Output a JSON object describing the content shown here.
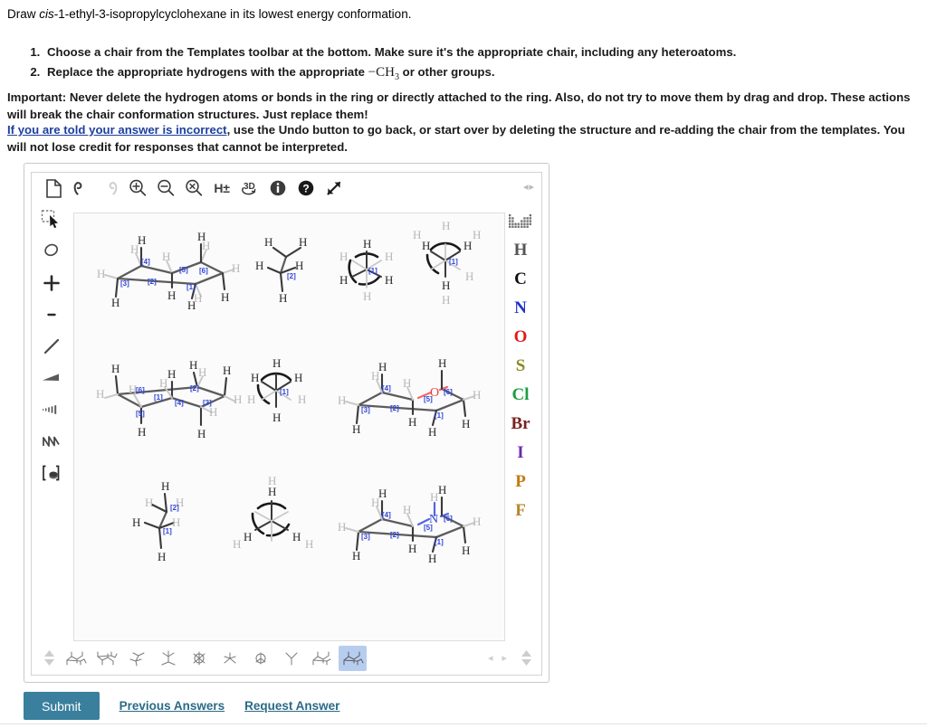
{
  "prompt": {
    "pre": "Draw ",
    "italic": "cis",
    "post": "-1-ethyl-3-isopropylcyclohexane in its lowest energy conformation."
  },
  "steps": [
    "Choose a chair from the Templates toolbar at the bottom. Make sure it's the appropriate chair, including any heteroatoms.",
    "Replace the appropriate hydrogens with the appropriate"
  ],
  "step2_formula": "CH3",
  "step2_tail": "or other groups.",
  "important": "Important: Never delete the hydrogen atoms or bonds in the ring or directly attached to the ring. Also, do not try to move them by drag and drop. These actions will break the chair conformation structures. Just replace them!",
  "note": {
    "link": "If you are told your answer is incorrect",
    "rest": ", use the Undo button to go back, or start over by deleting the structure and re-adding the chair from the templates. You will not lose credit for responses that cannot be interpreted."
  },
  "editor": {
    "toolbar_top": [
      {
        "name": "new-document-icon",
        "label": "New",
        "enabled": true
      },
      {
        "name": "undo-icon",
        "label": "Undo",
        "enabled": true
      },
      {
        "name": "redo-icon",
        "label": "Redo",
        "enabled": false
      },
      {
        "name": "zoom-in-icon",
        "label": "Zoom In",
        "enabled": true
      },
      {
        "name": "zoom-out-icon",
        "label": "Zoom Out",
        "enabled": true
      },
      {
        "name": "zoom-reset-icon",
        "label": "Reset Zoom",
        "enabled": true
      },
      {
        "name": "hydrogen-toggle-icon",
        "label": "H±",
        "enabled": true
      },
      {
        "name": "three-d-icon",
        "label": "3D",
        "enabled": true
      },
      {
        "name": "info-icon",
        "label": "Info",
        "enabled": true
      },
      {
        "name": "help-icon",
        "label": "Help",
        "enabled": true
      },
      {
        "name": "expand-icon",
        "label": "Expand",
        "enabled": true
      }
    ],
    "toolbar_left": [
      {
        "name": "select-tool",
        "label": "Select"
      },
      {
        "name": "eraser-tool",
        "label": "Eraser"
      },
      {
        "name": "increase-charge-tool",
        "label": "+"
      },
      {
        "name": "decrease-charge-tool",
        "label": "-"
      },
      {
        "name": "single-bond-tool",
        "label": "Single bond"
      },
      {
        "name": "wedge-bond-tool",
        "label": "Wedge bond"
      },
      {
        "name": "hash-bond-tool",
        "label": "Hash bond"
      },
      {
        "name": "chain-tool",
        "label": "Chain"
      },
      {
        "name": "bracket-tool",
        "label": "Bracket"
      }
    ],
    "elements": [
      {
        "symbol": "H",
        "color": "#555555"
      },
      {
        "symbol": "C",
        "color": "#101010"
      },
      {
        "symbol": "N",
        "color": "#2233cc"
      },
      {
        "symbol": "O",
        "color": "#e01b1b"
      },
      {
        "symbol": "S",
        "color": "#8a8a21"
      },
      {
        "symbol": "Cl",
        "color": "#1e9e3e"
      },
      {
        "symbol": "Br",
        "color": "#7a2020"
      },
      {
        "symbol": "I",
        "color": "#6a2bb0"
      },
      {
        "symbol": "P",
        "color": "#c27a12"
      },
      {
        "symbol": "F",
        "color": "#b5872a"
      }
    ],
    "periodic_table_icon": "periodic-table-icon",
    "nav_arrows": {
      "left": "◂",
      "right": "▸"
    },
    "canvas_structures": [
      {
        "name": "cyclohexane-chair-a",
        "type": "chair",
        "labels": [
          "[1]",
          "[2]",
          "[3]",
          "[4]",
          "[5]",
          "[6]"
        ],
        "heteroatom": null
      },
      {
        "name": "ethane-sawhorse-a",
        "type": "sawhorse",
        "labels": [
          "[2]"
        ],
        "heteroatom": null
      },
      {
        "name": "ethane-newman-staggered-a",
        "type": "newman",
        "labels": [
          "[1]"
        ],
        "heteroatom": null
      },
      {
        "name": "ethane-newman-staggered-b",
        "type": "newman",
        "labels": [
          "[1]"
        ],
        "heteroatom": null
      },
      {
        "name": "cyclohexane-chair-b",
        "type": "chair",
        "labels": [
          "[1]",
          "[2]",
          "[3]",
          "[4]",
          "[5]",
          "[6]"
        ],
        "heteroatom": null
      },
      {
        "name": "ethane-newman-eclipsed-a",
        "type": "newman",
        "labels": [
          "[1]"
        ],
        "heteroatom": null
      },
      {
        "name": "oxane-chair",
        "type": "chair",
        "labels": [
          "[1]",
          "[2]",
          "[3]",
          "[4]",
          "[5]",
          "[6]"
        ],
        "heteroatom": "O"
      },
      {
        "name": "ethane-sawhorse-b",
        "type": "sawhorse",
        "labels": [
          "[1]",
          "[2]"
        ],
        "heteroatom": null
      },
      {
        "name": "ethane-newman-eclipsed-b",
        "type": "newman",
        "labels": [],
        "heteroatom": null
      },
      {
        "name": "piperidine-chair",
        "type": "chair",
        "labels": [
          "[1]",
          "[2]",
          "[3]",
          "[4]",
          "[5]",
          "[6]"
        ],
        "heteroatom": "N"
      }
    ],
    "templates": [
      {
        "name": "template-chair-1",
        "type": "chair",
        "active": false
      },
      {
        "name": "template-chair-2",
        "type": "chair",
        "active": false
      },
      {
        "name": "template-sawhorse-1",
        "type": "sawhorse",
        "active": false
      },
      {
        "name": "template-sawhorse-2",
        "type": "sawhorse",
        "active": false
      },
      {
        "name": "template-newman-1",
        "type": "newman",
        "active": false
      },
      {
        "name": "template-newman-2",
        "type": "newman",
        "active": false
      },
      {
        "name": "template-newman-3",
        "type": "newman",
        "active": false
      },
      {
        "name": "template-newman-4",
        "type": "newman",
        "active": false
      },
      {
        "name": "template-chair-3",
        "type": "chair",
        "active": false
      },
      {
        "name": "template-chair-4",
        "type": "chair",
        "active": true
      }
    ]
  },
  "footer": {
    "submit": "Submit",
    "previous_answers": "Previous Answers",
    "request_answer": "Request Answer"
  },
  "colors": {
    "submit_bg": "#3a7f9d",
    "link": "#2a6a86",
    "note_link": "#1d3fa0",
    "template_active": "#b6cdf0",
    "atom_label": "#2f44d8"
  }
}
